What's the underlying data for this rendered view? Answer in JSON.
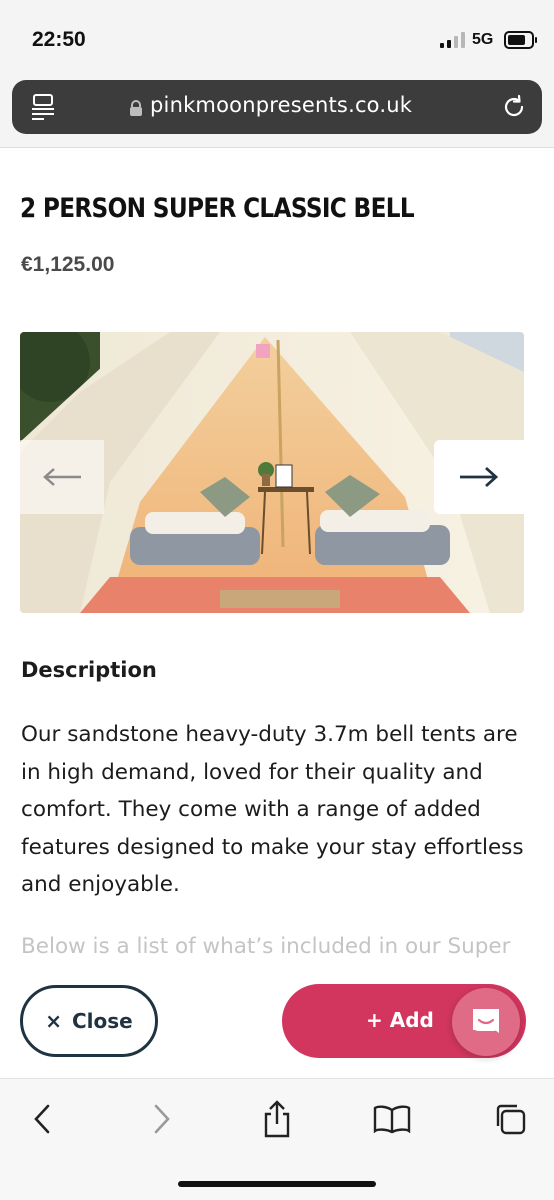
{
  "status_bar": {
    "time": "22:50",
    "network": "5G",
    "signal_bars_active": 2,
    "signal_bars_total": 4
  },
  "browser": {
    "url": "pinkmoonpresents.co.uk",
    "icons": [
      "reader-icon",
      "lock-icon",
      "reload-icon"
    ]
  },
  "product": {
    "title": "2 PERSON SUPER CLASSIC BELL",
    "price": "€1,125.00"
  },
  "gallery": {
    "prev_label": "←",
    "next_label": "→"
  },
  "description": {
    "heading": "Description",
    "body": "Our sandstone heavy-duty 3.7m bell tents are in high demand, loved for their quality and comfort. They come with a range of added features designed to make your stay effortless and enjoyable.",
    "faded": "Below is a list of what’s included in our Super"
  },
  "actions": {
    "close_icon": "×",
    "close_label": "Close",
    "add_icon": "+",
    "add_label": "Add",
    "chat_icon": "chat-icon"
  },
  "toolbar": {
    "icons": [
      "back-icon",
      "forward-icon",
      "share-icon",
      "bookmarks-icon",
      "tabs-icon"
    ]
  },
  "colors": {
    "accent": "#d2365f",
    "dark": "#1f3340",
    "chat": "#e06b86"
  }
}
